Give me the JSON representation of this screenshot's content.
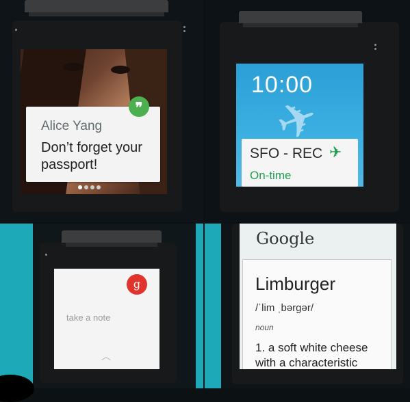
{
  "panels": {
    "notification": {
      "sender": "Alice Yang",
      "message": "Don’t forget your passport!",
      "app_icon": "hangouts-icon",
      "page_count": 4,
      "active_page": 0
    },
    "flight": {
      "time": "10:00",
      "flight_route": "SFO - REC",
      "status": "On-time",
      "icon": "airplane-icon",
      "accent_color": "#1f9d4e"
    },
    "note": {
      "prompt": "take a note",
      "badge": "g",
      "badge_color": "#e0352f",
      "icon": "chevron-up-icon"
    },
    "dictionary": {
      "brand": "Google",
      "word": "Limburger",
      "pronunciation": "/ˈlim ˌbərgər/",
      "part_of_speech": "noun",
      "definition": "1. a soft white cheese with a characteristic"
    }
  }
}
